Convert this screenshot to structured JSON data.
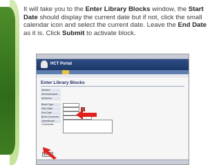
{
  "instructions": {
    "p1": "It will take you to the ",
    "b1": "Enter Library Blocks",
    "p2": " window, the ",
    "b2": "Start Date",
    "p3": " should display the current date but if not, click the small calendar icon and select the current date. Leave the ",
    "b3": "End Date",
    "p4": " as it is. Click ",
    "b4": "Submit",
    "p5": " to activate block."
  },
  "screenshot": {
    "brand": "HCT Portal",
    "page_title": "Enter Library Blocks",
    "field_labels": [
      "Student",
      "Semester/year",
      "Instructor",
      "Block Type",
      "Start Date",
      "End Date",
      "Block Comment",
      "Operational Comments"
    ],
    "submit_label": "Submit"
  },
  "colors": {
    "arrow": "#e0201b",
    "leaf_dark": "#3f7d22",
    "leaf_light": "#9fcf66"
  }
}
